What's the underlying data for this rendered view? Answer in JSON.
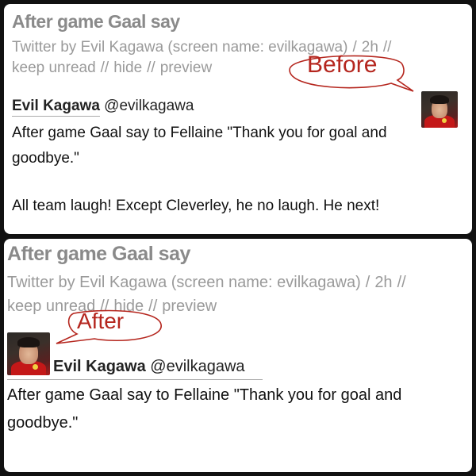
{
  "before": {
    "title": "After game Gaal say",
    "meta_source": "Twitter by Evil Kagawa (screen name: evilkagawa)",
    "meta_time": "2h",
    "actions": [
      "keep unread",
      "hide",
      "preview"
    ],
    "author_name": "Evil Kagawa",
    "author_handle": "@evilkagawa",
    "tweet_line1": "After game Gaal say to Fellaine \"Thank you for goal and",
    "tweet_line2": "goodbye.\"",
    "tweet_line3": "All team laugh! Except Cleverley, he no laugh. He next!",
    "label": "Before"
  },
  "after": {
    "title": "After game Gaal say",
    "meta_source": "Twitter by Evil Kagawa (screen name: evilkagawa)",
    "meta_time": "2h",
    "actions": [
      "keep unread",
      "hide",
      "preview"
    ],
    "author_name": "Evil Kagawa",
    "author_handle": "@evilkagawa",
    "tweet_line1": "After game Gaal say to Fellaine \"Thank you for goal and",
    "tweet_line2": "goodbye.\"",
    "label": "After"
  },
  "colors": {
    "annotation": "#b5261e",
    "title_gray": "#8a8a8a",
    "meta_gray": "#9a9a9a"
  }
}
